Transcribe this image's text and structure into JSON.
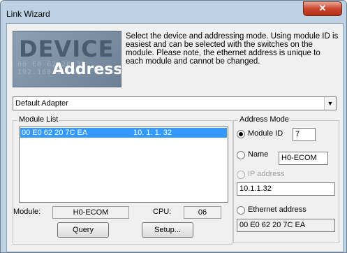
{
  "window": {
    "title": "Link Wizard",
    "close_glyph": "✕"
  },
  "logo": {
    "line1": "DEVICE",
    "line2": "Address",
    "bg_text": "00 E0 62 20 33 192.168.1.101"
  },
  "description": "Select the device and addressing mode. Using module ID is easiest and can be selected with the switches on the module. Please note, the ethernet address is unique to each module and cannot be changed.",
  "adapter": {
    "value": "Default Adapter"
  },
  "module_list": {
    "label": "Module List",
    "rows": [
      {
        "ethernet": "00 E0 62 20 7C EA",
        "ip": "10.  1.  1. 32"
      }
    ],
    "module_label": "Module:",
    "module_value": "H0-ECOM",
    "cpu_label": "CPU:",
    "cpu_value": "06",
    "query_label": "Query",
    "setup_label": "Setup..."
  },
  "address_mode": {
    "label": "Address Mode",
    "module_id_label": "Module ID",
    "module_id_value": "7",
    "name_label": "Name",
    "name_value": "H0-ECOM",
    "ip_label": "IP address",
    "ip_value": "10.1.1.32",
    "ethernet_label": "Ethernet address",
    "ethernet_value": "00 E0 62 20 7C EA",
    "selected": "Module ID"
  }
}
